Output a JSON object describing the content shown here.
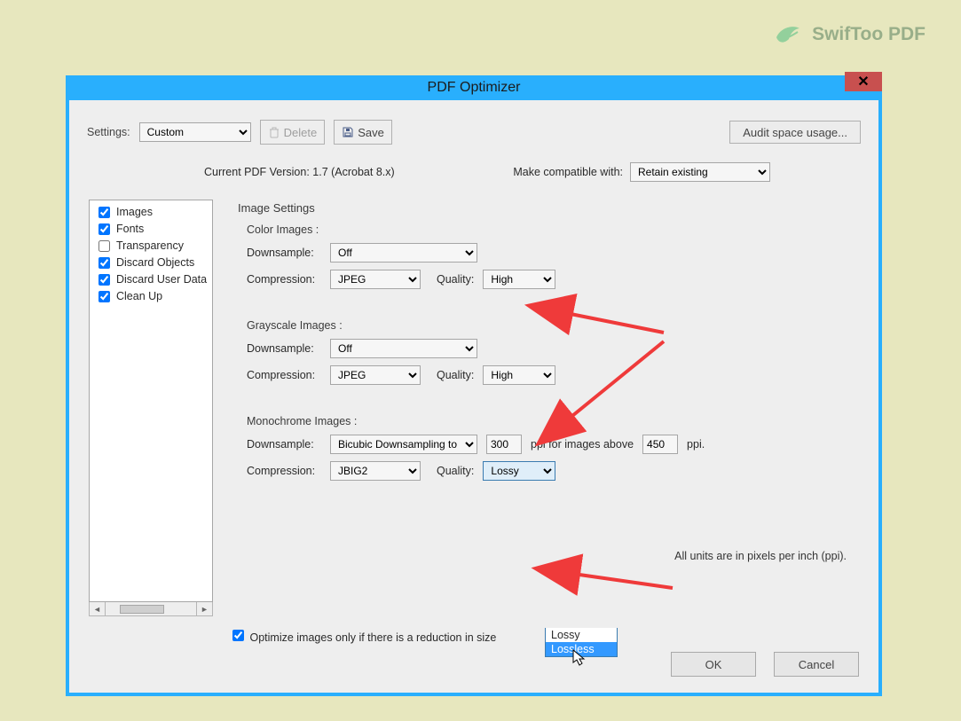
{
  "brand": "SwifToo PDF",
  "window": {
    "title": "PDF Optimizer",
    "settings_label": "Settings:",
    "settings_value": "Custom",
    "delete_label": "Delete",
    "save_label": "Save",
    "audit_label": "Audit space usage...",
    "version_text": "Current PDF Version: 1.7 (Acrobat 8.x)",
    "compat_label": "Make compatible with:",
    "compat_value": "Retain existing",
    "units_note": "All units are in pixels per inch (ppi).",
    "optimize_label": "Optimize images only if there is a reduction in size",
    "ok": "OK",
    "cancel": "Cancel"
  },
  "sidebar": {
    "items": [
      {
        "label": "Images",
        "checked": true
      },
      {
        "label": "Fonts",
        "checked": true
      },
      {
        "label": "Transparency",
        "checked": false
      },
      {
        "label": "Discard Objects",
        "checked": true
      },
      {
        "label": "Discard User Data",
        "checked": true
      },
      {
        "label": "Clean Up",
        "checked": true
      }
    ]
  },
  "main": {
    "heading": "Image Settings",
    "color": {
      "title": "Color Images :",
      "downsample_label": "Downsample:",
      "downsample_value": "Off",
      "compression_label": "Compression:",
      "compression_value": "JPEG",
      "quality_label": "Quality:",
      "quality_value": "High"
    },
    "gray": {
      "title": "Grayscale Images :",
      "downsample_label": "Downsample:",
      "downsample_value": "Off",
      "compression_label": "Compression:",
      "compression_value": "JPEG",
      "quality_label": "Quality:",
      "quality_value": "High"
    },
    "mono": {
      "title": "Monochrome Images :",
      "downsample_label": "Downsample:",
      "downsample_value": "Bicubic Downsampling to",
      "ppi_value": "300",
      "ppi_between": "ppi for images above",
      "ppi_above": "450",
      "ppi_suffix": "ppi.",
      "compression_label": "Compression:",
      "compression_value": "JBIG2",
      "quality_label": "Quality:",
      "quality_value": "Lossy",
      "options": [
        "Lossy",
        "Lossless"
      ]
    }
  }
}
